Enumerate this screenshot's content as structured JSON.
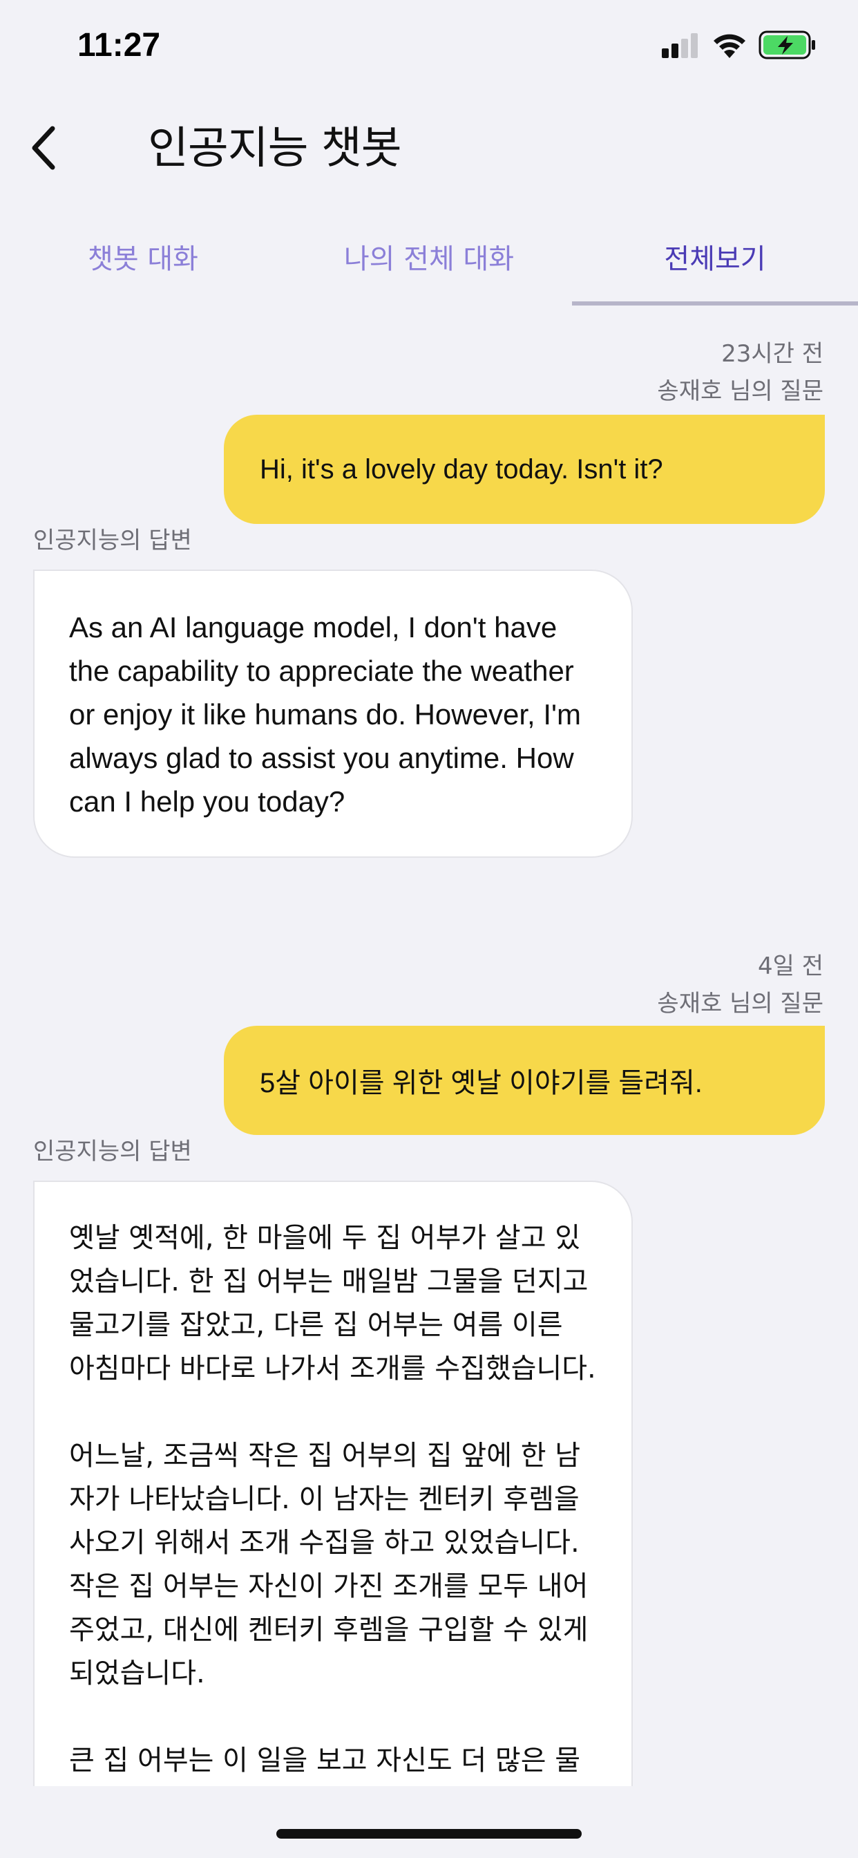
{
  "status_bar": {
    "time": "11:27"
  },
  "header": {
    "title": "인공지능 챗봇"
  },
  "tabs": [
    {
      "label": "챗봇 대화",
      "active": false
    },
    {
      "label": "나의 전체 대화",
      "active": false
    },
    {
      "label": "전체보기",
      "active": true
    }
  ],
  "conversations": [
    {
      "time": "23시간 전",
      "asker": "송재호 님의 질문",
      "question": "Hi, it's a lovely day today. Isn't it?",
      "answer_label": "인공지능의 답변",
      "answer": "As an AI language model, I don't have the capability to appreciate the weather or enjoy it like humans do. However, I'm always glad to assist you anytime. How can I help you today?"
    },
    {
      "time": "4일 전",
      "asker": "송재호 님의 질문",
      "question": "5살 아이를 위한 옛날 이야기를 들려줘.",
      "answer_label": "인공지능의 답변",
      "answer": "옛날 옛적에, 한 마을에 두 집 어부가 살고 있었습니다. 한 집 어부는 매일밤 그물을 던지고 물고기를 잡았고, 다른 집 어부는 여름 이른 아침마다 바다로 나가서 조개를 수집했습니다.\n\n어느날, 조금씩 작은 집 어부의 집 앞에 한 남자가 나타났습니다. 이 남자는 켄터키 후렘을 사오기 위해서 조개 수집을 하고 있었습니다. 작은 집 어부는 자신이 가진 조개를 모두 내어주었고, 대신에 켄터키 후렘을 구입할 수 있게 되었습니다.\n\n큰 집 어부는 이 일을 보고 자신도 더 많은 물고"
    }
  ],
  "colors": {
    "background": "#f2f2f7",
    "user_bubble": "#f7d84a",
    "tab_text": "#8b7fd8",
    "tab_active_text": "#4a3bb5",
    "battery_green": "#4cd964"
  },
  "icons": {
    "back": "chevron-left-icon",
    "signal": "cellular-signal-icon",
    "wifi": "wifi-icon",
    "battery": "battery-charging-icon"
  }
}
